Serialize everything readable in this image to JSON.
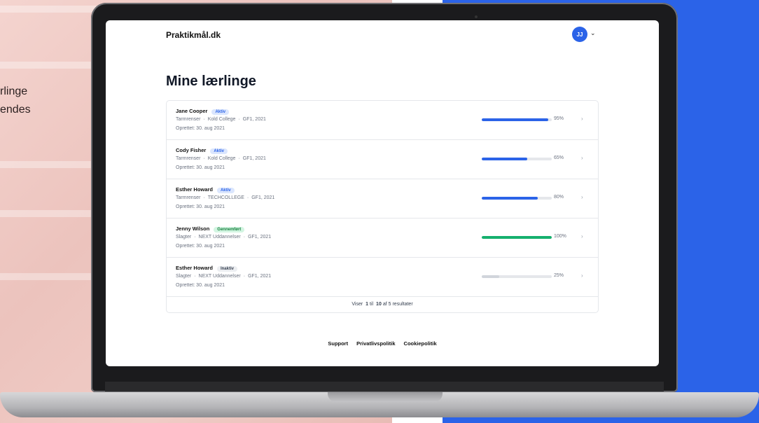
{
  "side_text": [
    "rlinge",
    "endes"
  ],
  "app": {
    "brand": "Praktikmål.dk",
    "avatar_initials": "JJ",
    "page_title": "Mine lærlinge"
  },
  "apprentices": [
    {
      "name": "Jane Cooper",
      "status": "Aktiv",
      "status_kind": "aktiv",
      "trade": "Tarmrenser",
      "school": "Kold College",
      "program": "GF1, 2021",
      "created": "Oprettet: 30. aug 2021",
      "progress": 95,
      "progress_label": "95%",
      "bar_color": "#2b63e8"
    },
    {
      "name": "Cody Fisher",
      "status": "Aktiv",
      "status_kind": "aktiv",
      "trade": "Tarmrenser",
      "school": "Kold College",
      "program": "GF1, 2021",
      "created": "Oprettet: 30. aug 2021",
      "progress": 65,
      "progress_label": "65%",
      "bar_color": "#2b63e8"
    },
    {
      "name": "Esther Howard",
      "status": "Aktiv",
      "status_kind": "aktiv",
      "trade": "Tarmrenser",
      "school": "TECHCOLLEGE",
      "program": "GF1, 2021",
      "created": "Oprettet: 30. aug 2021",
      "progress": 80,
      "progress_label": "80%",
      "bar_color": "#2b63e8"
    },
    {
      "name": "Jenny Wilson",
      "status": "Gennemført",
      "status_kind": "done",
      "trade": "Slagter",
      "school": "NEXT Uddannelser",
      "program": "GF1, 2021",
      "created": "Oprettet: 30. aug 2021",
      "progress": 100,
      "progress_label": "100%",
      "bar_color": "#16b06e"
    },
    {
      "name": "Esther Howard",
      "status": "Inaktiv",
      "status_kind": "inakt",
      "trade": "Slagter",
      "school": "NEXT Uddannelser",
      "program": "GF1, 2021",
      "created": "Oprettet: 30. aug 2021",
      "progress": 25,
      "progress_label": "25%",
      "bar_color": "#d1d5db"
    }
  ],
  "pager": {
    "prefix": "Viser",
    "from": "1",
    "mid": "til",
    "to": "10",
    "suffix": "af 5 resultater"
  },
  "footer": {
    "support": "Support",
    "privacy": "Privatlivspolitik",
    "cookies": "Cookiepolitik"
  },
  "colors": {
    "accent": "#2b63e8",
    "success": "#16b06e",
    "background_right": "#2b63e8"
  }
}
